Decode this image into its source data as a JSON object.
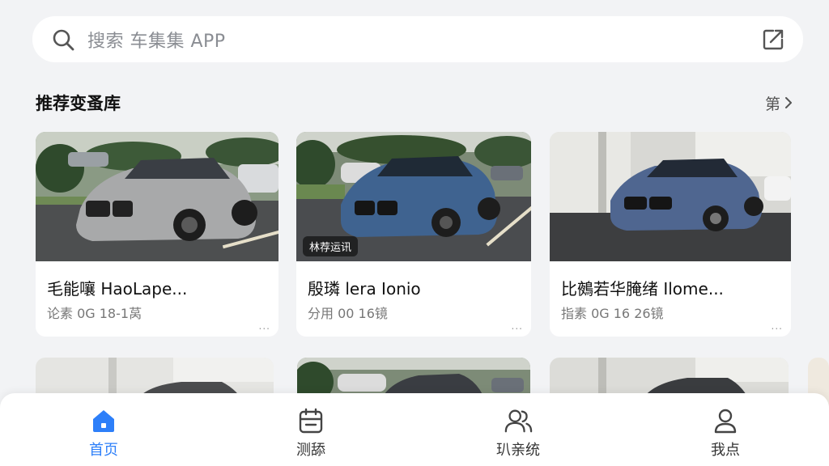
{
  "search": {
    "placeholder": "搜索 车集集 APP"
  },
  "section": {
    "title": "推荐变蚤库",
    "more_label": "第"
  },
  "cards": [
    {
      "title": "毛能嚷 HaoLape...",
      "meta": "论素 0G 18-1莴",
      "more": "...",
      "tag": ""
    },
    {
      "title": "殷璘 lera Ionio",
      "meta": "分用 00 16镜",
      "more": "...",
      "tag": "林荐运讯"
    },
    {
      "title": "比鵺若华腌绪 Ilome...",
      "meta": "指素 0G 16 26镜",
      "more": "...",
      "tag": ""
    }
  ],
  "nav": [
    {
      "label": "首页",
      "icon": "home-icon",
      "active": true
    },
    {
      "label": "测舔",
      "icon": "calendar-icon",
      "active": false
    },
    {
      "label": "玐亲统",
      "icon": "users-icon",
      "active": false
    },
    {
      "label": "我点",
      "icon": "user-icon",
      "active": false
    }
  ],
  "colors": {
    "accent": "#2d7ff9",
    "background": "#f2f3f5"
  }
}
